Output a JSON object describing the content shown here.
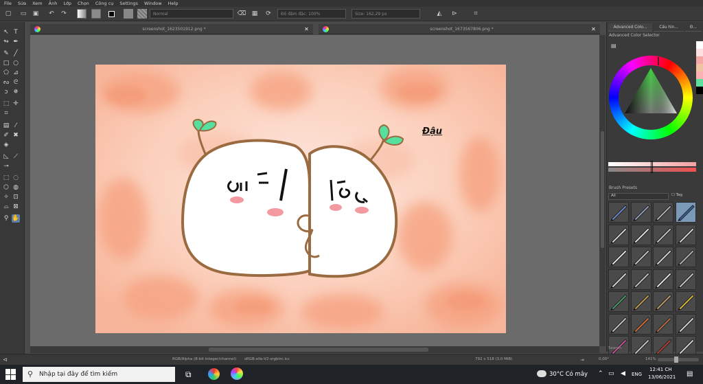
{
  "menu": [
    "File",
    "Sửa",
    "Xem",
    "Ảnh",
    "Lớp",
    "Chọn",
    "Công cụ",
    "Settings",
    "Window",
    "Help"
  ],
  "toolbar": {
    "blend_mode": "Normal",
    "opacity": "Độ đậm đặc: 100%",
    "size": "Size: 162,29 px"
  },
  "tabs": [
    {
      "title": "screenshot_1623501912.png *"
    },
    {
      "title": "screenshot_1673567806.png *"
    }
  ],
  "canvas": {
    "signature": "Đậu"
  },
  "docker": {
    "tabs": [
      "Advanced Colo...",
      "Cấu hìn...",
      "Đ..."
    ],
    "color_selector_title": "Advanced Color Selector",
    "brush_presets_title": "Brush Presets",
    "preset_filter": "All",
    "tag_label": "Tag",
    "search_placeholder": "Search",
    "swatches": [
      "#ffffff",
      "#fde0e0",
      "#f5a8a8",
      "#f0c4a0",
      "#5ee0a0",
      "#000000"
    ]
  },
  "status": {
    "color_model": "RGB/Alpha (8-bit integer/channel)",
    "profile": "sRGB-elle-V2-srgbtrc.icc",
    "dimensions": "792 x 518 (3,0 MiB)",
    "rotation": "0,00°",
    "zoom": "141%"
  },
  "taskbar": {
    "search_placeholder": "Nhập tại đây để tìm kiếm",
    "weather": "30°C Có mây",
    "lang": "ENG",
    "time": "12:41 CH",
    "date": "13/06/2021"
  },
  "colors": {
    "accent": "#5a7fa8",
    "canvas_bg": "#f8c4ac",
    "outline": "#9a6a40",
    "leaf": "#55e0a0"
  }
}
